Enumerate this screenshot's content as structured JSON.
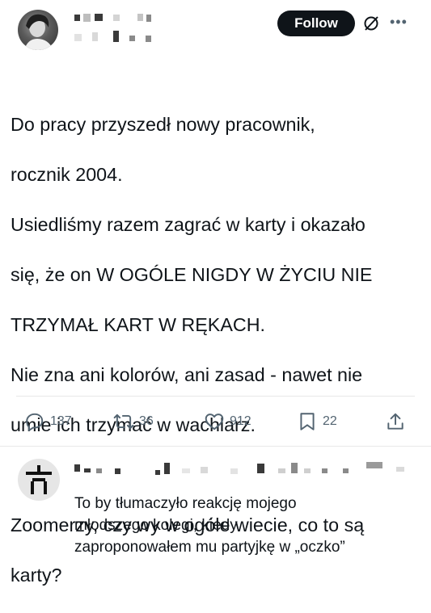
{
  "header": {
    "follow_label": "Follow",
    "grok_icon": "grok-slash-icon",
    "more_icon": "more-dots-icon"
  },
  "post": {
    "lines": [
      "Do pracy przyszedł nowy pracownik,",
      "rocznik 2004.",
      "Usiedliśmy razem zagrać w karty i okazało",
      "się, że on W OGÓLE NIGDY W ŻYCIU NIE",
      "TRZYMAŁ KART W RĘKACH.",
      "Nie zna ani kolorów, ani zasad - nawet nie",
      "umie ich trzymać w wachlarz.",
      "",
      "Zoomerzy, czy wy w ogóle wiecie, co to są",
      "karty?"
    ]
  },
  "actions": {
    "replies": "137",
    "reposts": "36",
    "likes": "912",
    "bookmarks": "22"
  },
  "reply": {
    "lines": [
      "To by tłumaczyło reakcję mojego",
      "młodszego kolegi, kiedy",
      "zaproponowałem mu partyjkę w „oczko”"
    ]
  },
  "colors": {
    "text": "#0f1419",
    "muted": "#536471",
    "button_bg": "#0f1419",
    "divider": "#e8e8e8"
  }
}
